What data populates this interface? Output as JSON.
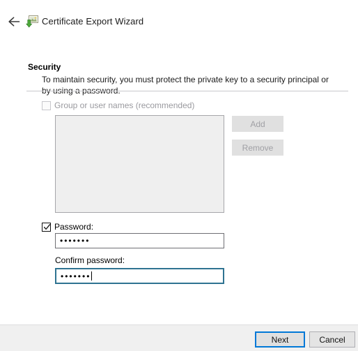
{
  "window": {
    "title": "Certificate Export Wizard",
    "back_icon": "back-arrow-icon",
    "app_icon": "certificate-export-icon"
  },
  "page": {
    "heading": "Security",
    "description": "To maintain security, you must protect the private key to a security principal or by using a password."
  },
  "group_or_user": {
    "label": "Group or user names (recommended)",
    "checked": false,
    "enabled": false
  },
  "listbox": {
    "items": [],
    "enabled": false
  },
  "side_buttons": {
    "add_label": "Add",
    "remove_label": "Remove",
    "add_enabled": false,
    "remove_enabled": false
  },
  "password": {
    "label": "Password:",
    "checked": true,
    "enabled": true,
    "value": "•••••••",
    "placeholder": "",
    "char_count": 7
  },
  "confirm_password": {
    "label": "Confirm password:",
    "value": "•••••••",
    "placeholder": "",
    "char_count": 7,
    "focused": true
  },
  "footer": {
    "next_label": "Next",
    "cancel_label": "Cancel"
  },
  "colors": {
    "focus_border": "#2f7391",
    "default_button_border": "#0078d7",
    "disabled_text": "#a0a0a5",
    "footer_background": "#f0f0f0",
    "listbox_background": "#efefef",
    "separator": "#c8c8cc"
  }
}
